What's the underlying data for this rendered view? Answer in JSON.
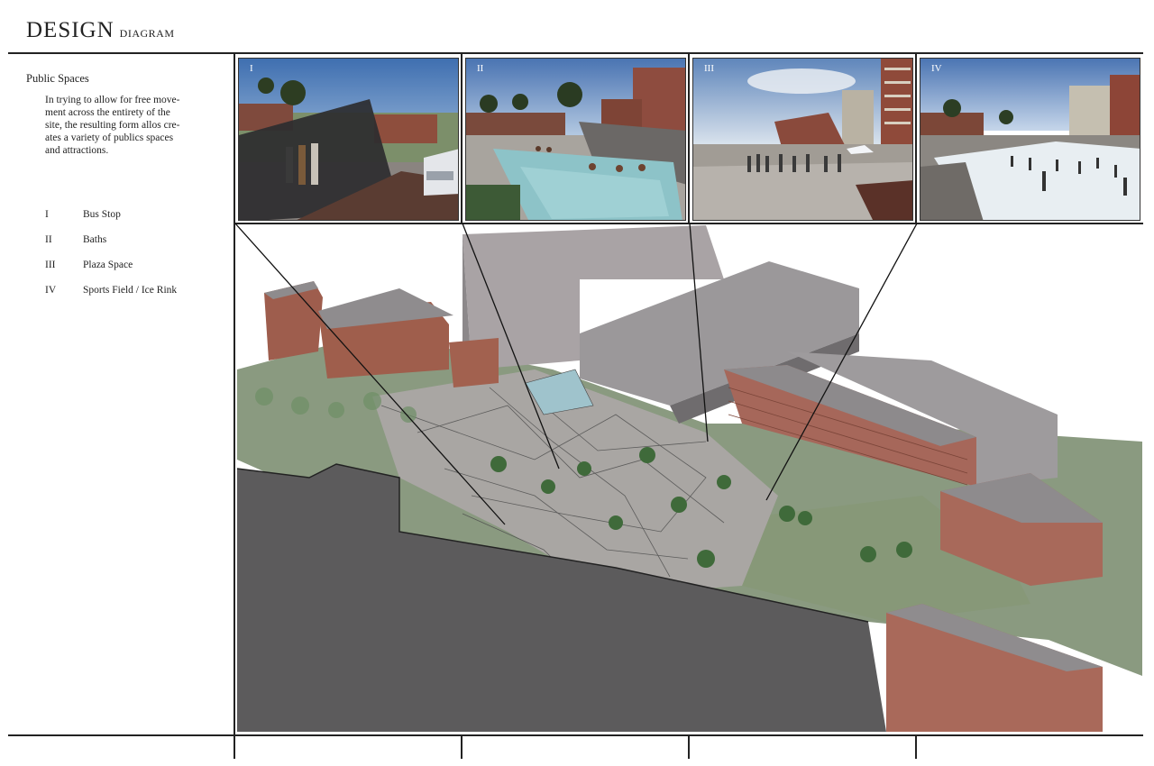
{
  "header": {
    "title": "Design",
    "subtitle": "diagram"
  },
  "sidebar": {
    "heading": "Public Spaces",
    "description": "In trying to allow for free move-\nment across the entirety of the\nsite, the resulting form allos cre-\nates a variety of publics spaces\nand attractions."
  },
  "legend": [
    {
      "numeral": "I",
      "label": "Bus Stop"
    },
    {
      "numeral": "II",
      "label": "Baths"
    },
    {
      "numeral": "III",
      "label": "Plaza Space"
    },
    {
      "numeral": "IV",
      "label": "Sports Field / Ice Rink"
    }
  ],
  "thumbnails": [
    {
      "numeral": "I",
      "icon": "bus-stop-render"
    },
    {
      "numeral": "II",
      "icon": "baths-render"
    },
    {
      "numeral": "III",
      "icon": "plaza-render"
    },
    {
      "numeral": "IV",
      "icon": "ice-rink-render"
    }
  ],
  "colors": {
    "sky": "#6f93c2",
    "brick": "#9a5a4a",
    "grass": "#7f9575",
    "concrete": "#a6a3a0",
    "roof": "#8d8a8c",
    "ground_section": "#5c5b5c",
    "ice": "#e9eef2"
  }
}
